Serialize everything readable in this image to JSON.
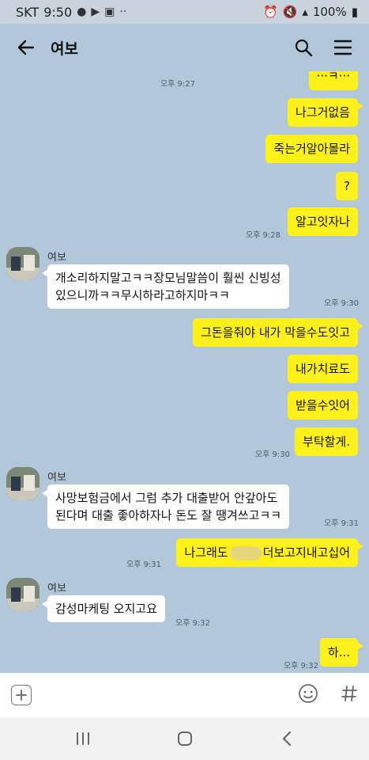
{
  "status_bar": {
    "carrier": "SKT",
    "time": "9:50",
    "battery": "100%"
  },
  "header": {
    "title": "여보"
  },
  "messages": [
    {
      "from": "me",
      "text": "···ㅋ···",
      "partial": true
    },
    {
      "time": "오후 9:27"
    },
    {
      "from": "me",
      "text": "나그거없음"
    },
    {
      "from": "me",
      "text": "죽는거알아몰라"
    },
    {
      "from": "me",
      "text": "?"
    },
    {
      "from": "me",
      "text": "알고잇자나",
      "time": "오후 9:28"
    },
    {
      "from": "them",
      "sender": "여보",
      "lines": [
        "개소리하지말고ㅋㅋ장모님말씀이 훨씬 신빙성",
        "있으니까ㅋㅋ무시하라고하지마ㅋㅋ"
      ],
      "time": "오후 9:30"
    },
    {
      "from": "me",
      "text": "그돈을줘야 내가 막을수도잇고"
    },
    {
      "from": "me",
      "text": "내가치료도"
    },
    {
      "from": "me",
      "text": "받을수잇어"
    },
    {
      "from": "me",
      "text": "부탁할게.",
      "time": "오후 9:30"
    },
    {
      "from": "them",
      "sender": "여보",
      "lines": [
        "사망보험금에서 그럼 추가 대출받어 안갚아도",
        "된다며 대출 좋아하자나 돈도 잘 땡겨쓰고ㅋㅋ"
      ],
      "time": "오후 9:31"
    },
    {
      "from": "me",
      "text_left": "나그래도",
      "text_right": "더보고지내고십어",
      "time": "오후 9:31"
    },
    {
      "from": "them",
      "sender": "여보",
      "lines": [
        "감성마케팅 오지고요"
      ],
      "time": "오후 9:32"
    },
    {
      "from": "me",
      "text": "하...",
      "time": "오후 9:32"
    }
  ],
  "input": {
    "placeholder": ""
  },
  "colors": {
    "background": "#b2c7d9",
    "my_bubble": "#fef01b",
    "their_bubble": "#ffffff"
  },
  "icons": [
    "back-arrow-icon",
    "search-icon",
    "menu-icon",
    "plus-icon",
    "emoji-icon",
    "hash-icon",
    "recent-apps-icon",
    "home-icon",
    "back-nav-icon"
  ]
}
